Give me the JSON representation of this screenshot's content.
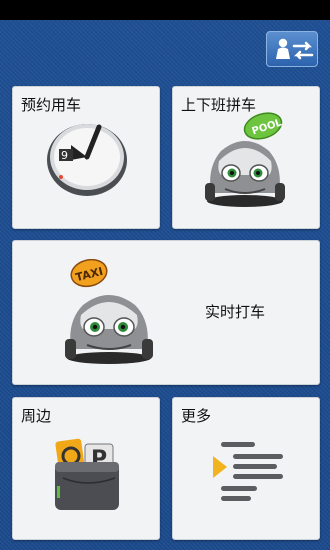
{
  "header": {
    "switch_button": "switch-user-icon"
  },
  "tiles": [
    {
      "label": "预约用车",
      "icon": "clock-icon"
    },
    {
      "label": "上下班拼车",
      "icon": "pool-car-icon",
      "badge": "POOL"
    },
    {
      "label": "实时打车",
      "icon": "taxi-car-icon",
      "badge": "TAXI"
    },
    {
      "label": "周边",
      "icon": "nearby-wallet-icon"
    },
    {
      "label": "更多",
      "icon": "more-list-icon"
    }
  ],
  "colors": {
    "background": "#1f5fae",
    "tile": "#f2f3f5",
    "pool_badge": "#6cc43f",
    "taxi_badge": "#f2a11f"
  }
}
